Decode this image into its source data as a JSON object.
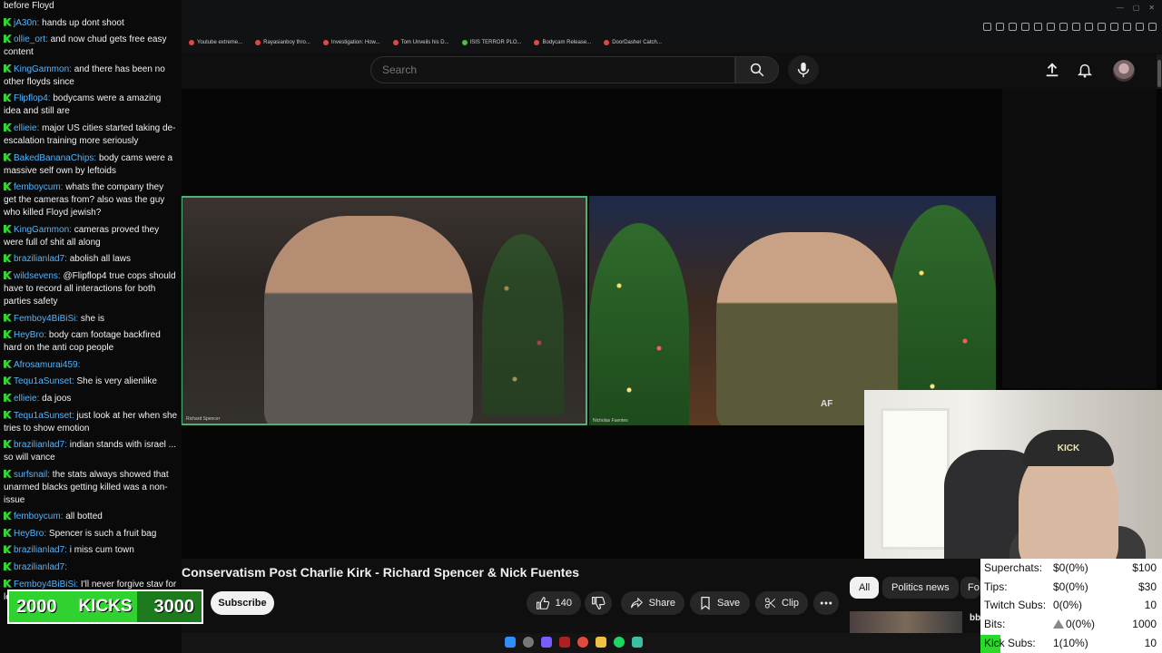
{
  "browser": {
    "bookmarks": [
      "Youtube extreme...",
      "Rayasianboy thro...",
      "Investigation: How...",
      "Tom Unveils his D...",
      "ISIS TERROR PLO...",
      "Bodycam Release...",
      "DoorDasher Catch..."
    ]
  },
  "youtube": {
    "search_placeholder": "Search",
    "video_title": "Conservatism Post Charlie Kirk - Richard Spencer & Nick Fuentes",
    "title_visible": "harlie Kirk - Richard Spencer & Nick Fuentes",
    "channel_overlay": "Conservatism Post",
    "subscribe_label": "Subscribe",
    "like_count": "140",
    "share_label": "Share",
    "save_label": "Save",
    "clip_label": "Clip",
    "chips": [
      "All",
      "Politics news",
      "Fo"
    ],
    "rec_title_fragment": "bb",
    "pane_left_name": "Richard Spencer",
    "pane_right_name": "Nicholas Fuentes",
    "pane_logo": "AF"
  },
  "webcam": {
    "hat_text": "KICK"
  },
  "stats": [
    {
      "label": "Superchats:",
      "value": "$0(0%)",
      "goal": "$100"
    },
    {
      "label": "Tips:",
      "value": "$0(0%)",
      "goal": "$30"
    },
    {
      "label": "Twitch Subs:",
      "value": "0(0%)",
      "goal": "10"
    },
    {
      "label": "Bits:",
      "value": "0(0%)",
      "goal": "1000"
    },
    {
      "label": "Kick Subs:",
      "value": "1(10%)",
      "goal": "10"
    }
  ],
  "kicks": {
    "current": "2000",
    "label": "KICKS",
    "goal": "3000",
    "progress": 0.667
  },
  "chat": [
    {
      "user": "",
      "text": "before Floyd"
    },
    {
      "user": "jA30n:",
      "text": "hands up dont shoot"
    },
    {
      "user": "ollie_ort:",
      "text": "and now chud gets free easy content"
    },
    {
      "user": "KingGammon:",
      "text": "and there has been no other floyds since"
    },
    {
      "user": "Flipflop4:",
      "text": "bodycams were a amazing idea and still are"
    },
    {
      "user": "ellieie:",
      "text": "major US cities started taking de-escalation training more seriously"
    },
    {
      "user": "BakedBananaChips:",
      "text": "body cams were a massive self own by leftoids"
    },
    {
      "user": "femboycum:",
      "text": "whats the company they get the cameras from? also was the guy who killed Floyd jewish?"
    },
    {
      "user": "KingGammon:",
      "text": "cameras proved they were full of shit all along"
    },
    {
      "user": "brazilianlad7:",
      "text": "abolish all laws"
    },
    {
      "user": "wildsevens:",
      "text": "@Flipflop4 true cops should have to record all interactions for both parties safety"
    },
    {
      "user": "Femboy4BiBiSi:",
      "text": "she is"
    },
    {
      "user": "HeyBro:",
      "text": "body cam footage backfired hard on the anti cop people"
    },
    {
      "user": "Afrosamurai459:",
      "text": ""
    },
    {
      "user": "Tequ1aSunset:",
      "text": "She is very alienlike"
    },
    {
      "user": "ellieie:",
      "text": "da joos"
    },
    {
      "user": "Tequ1aSunset:",
      "text": "just look at her when she tries to show emotion"
    },
    {
      "user": "brazilianlad7:",
      "text": "indian stands with israel ... so will vance"
    },
    {
      "user": "surfsnail:",
      "text": "the stats always showed that unarmed blacks getting killed was a non-issue"
    },
    {
      "user": "femboycum:",
      "text": "all botted"
    },
    {
      "user": "HeyBro:",
      "text": "Spencer is such a fruit bag"
    },
    {
      "user": "brazilianlad7:",
      "text": "i miss cum town"
    },
    {
      "user": "brazilianlad7:",
      "text": ""
    },
    {
      "user": "",
      "text": ""
    },
    {
      "user": "Femboy4BiBiSi:",
      "text": "I'll never forgive stav for leaving"
    }
  ],
  "colors": {
    "kick_green": "#2fd22f",
    "username_blue": "#52b6ff",
    "active_border": "#4ab37a"
  }
}
